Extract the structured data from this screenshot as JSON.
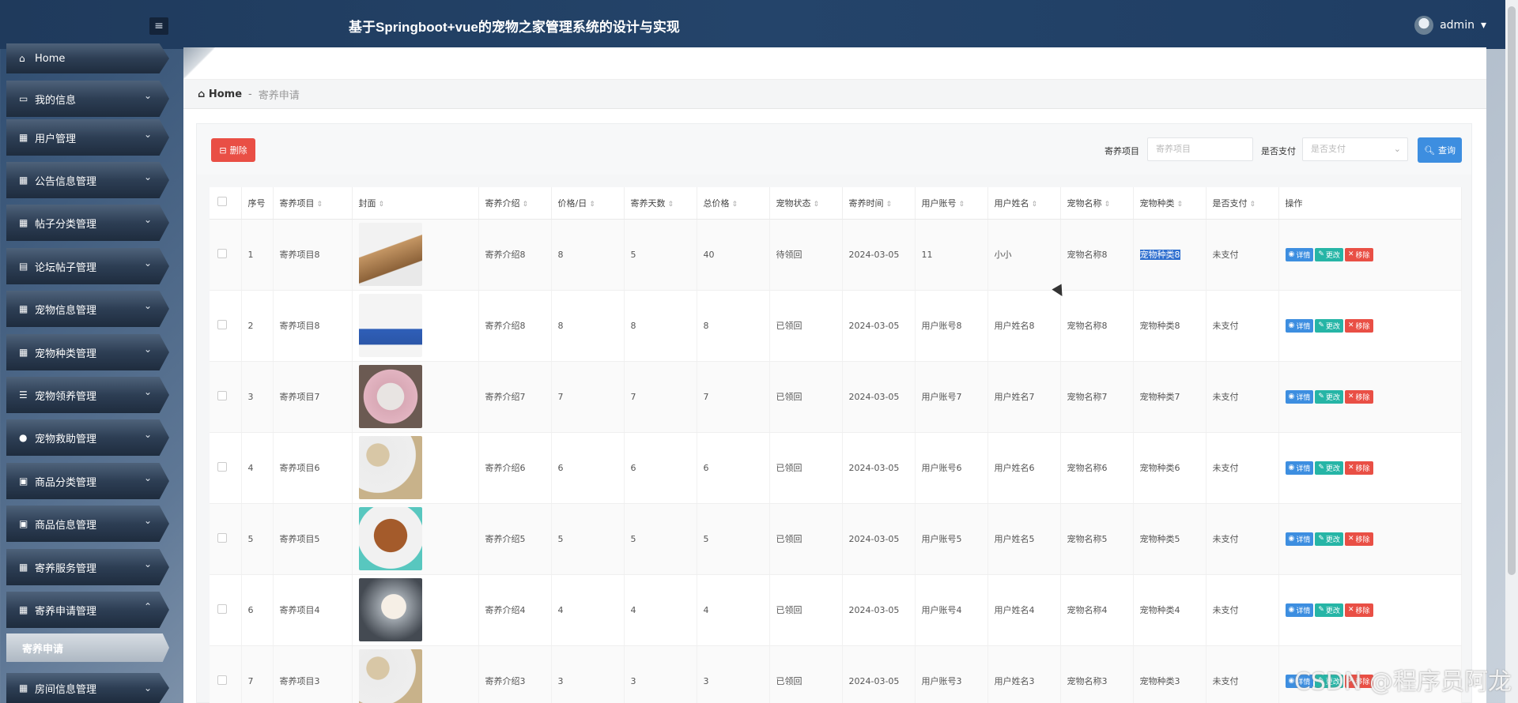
{
  "app": {
    "title": "基于Springboot+vue的宠物之家管理系统的设计与实现",
    "user": "admin"
  },
  "sidebar": {
    "items": [
      {
        "label": "Home",
        "icon": "home-icon"
      },
      {
        "label": "我的信息",
        "icon": "card-icon"
      },
      {
        "label": "用户管理",
        "icon": "grid-icon"
      },
      {
        "label": "公告信息管理",
        "icon": "grid-icon"
      },
      {
        "label": "帖子分类管理",
        "icon": "grid-icon"
      },
      {
        "label": "论坛帖子管理",
        "icon": "briefcase-icon"
      },
      {
        "label": "宠物信息管理",
        "icon": "grid-icon"
      },
      {
        "label": "宠物种类管理",
        "icon": "grid-icon"
      },
      {
        "label": "宠物领养管理",
        "icon": "list-icon"
      },
      {
        "label": "宠物救助管理",
        "icon": "user-icon"
      },
      {
        "label": "商品分类管理",
        "icon": "clipboard-check-icon"
      },
      {
        "label": "商品信息管理",
        "icon": "clipboard-icon"
      },
      {
        "label": "寄养服务管理",
        "icon": "grid-icon"
      },
      {
        "label": "寄养申请管理",
        "icon": "grid-icon"
      },
      {
        "label": "寄养申请",
        "icon": ""
      },
      {
        "label": "房间信息管理",
        "icon": "grid-icon"
      }
    ]
  },
  "breadcrumb": {
    "home": "Home",
    "sep": "-",
    "current": "寄养申请"
  },
  "toolbar": {
    "delete_label": "删除",
    "filter1_label": "寄养项目",
    "filter1_placeholder": "寄养项目",
    "filter2_label": "是否支付",
    "filter2_placeholder": "是否支付",
    "search_label": "查询"
  },
  "table": {
    "columns": [
      "序号",
      "寄养项目",
      "封面",
      "寄养介绍",
      "价格/日",
      "寄养天数",
      "总价格",
      "宠物状态",
      "寄养时间",
      "用户账号",
      "用户姓名",
      "宠物名称",
      "宠物种类",
      "是否支付",
      "操作"
    ],
    "ops": {
      "view": "详情",
      "edit": "更改",
      "del": "移除"
    },
    "rows": [
      {
        "no": "1",
        "item": "寄养项目8",
        "intro": "寄养介绍8",
        "price": "8",
        "days": "5",
        "total": "40",
        "status": "待领回",
        "time": "2024-03-05",
        "account": "11",
        "name": "小小",
        "pet": "宠物名称8",
        "kind": "宠物种类8",
        "paid": "未支付"
      },
      {
        "no": "2",
        "item": "寄养项目8",
        "intro": "寄养介绍8",
        "price": "8",
        "days": "8",
        "total": "8",
        "status": "已领回",
        "time": "2024-03-05",
        "account": "用户账号8",
        "name": "用户姓名8",
        "pet": "宠物名称8",
        "kind": "宠物种类8",
        "paid": "未支付"
      },
      {
        "no": "3",
        "item": "寄养项目7",
        "intro": "寄养介绍7",
        "price": "7",
        "days": "7",
        "total": "7",
        "status": "已领回",
        "time": "2024-03-05",
        "account": "用户账号7",
        "name": "用户姓名7",
        "pet": "宠物名称7",
        "kind": "宠物种类7",
        "paid": "未支付"
      },
      {
        "no": "4",
        "item": "寄养项目6",
        "intro": "寄养介绍6",
        "price": "6",
        "days": "6",
        "total": "6",
        "status": "已领回",
        "time": "2024-03-05",
        "account": "用户账号6",
        "name": "用户姓名6",
        "pet": "宠物名称6",
        "kind": "宠物种类6",
        "paid": "未支付"
      },
      {
        "no": "5",
        "item": "寄养项目5",
        "intro": "寄养介绍5",
        "price": "5",
        "days": "5",
        "total": "5",
        "status": "已领回",
        "time": "2024-03-05",
        "account": "用户账号5",
        "name": "用户姓名5",
        "pet": "宠物名称5",
        "kind": "宠物种类5",
        "paid": "未支付"
      },
      {
        "no": "6",
        "item": "寄养项目4",
        "intro": "寄养介绍4",
        "price": "4",
        "days": "4",
        "total": "4",
        "status": "已领回",
        "time": "2024-03-05",
        "account": "用户账号4",
        "name": "用户姓名4",
        "pet": "宠物名称4",
        "kind": "宠物种类4",
        "paid": "未支付"
      },
      {
        "no": "7",
        "item": "寄养项目3",
        "intro": "寄养介绍3",
        "price": "3",
        "days": "3",
        "total": "3",
        "status": "已领回",
        "time": "2024-03-05",
        "account": "用户账号3",
        "name": "用户姓名3",
        "pet": "宠物名称3",
        "kind": "宠物种类3",
        "paid": "未支付"
      }
    ]
  },
  "watermark": "CSDN @程序员阿龙"
}
